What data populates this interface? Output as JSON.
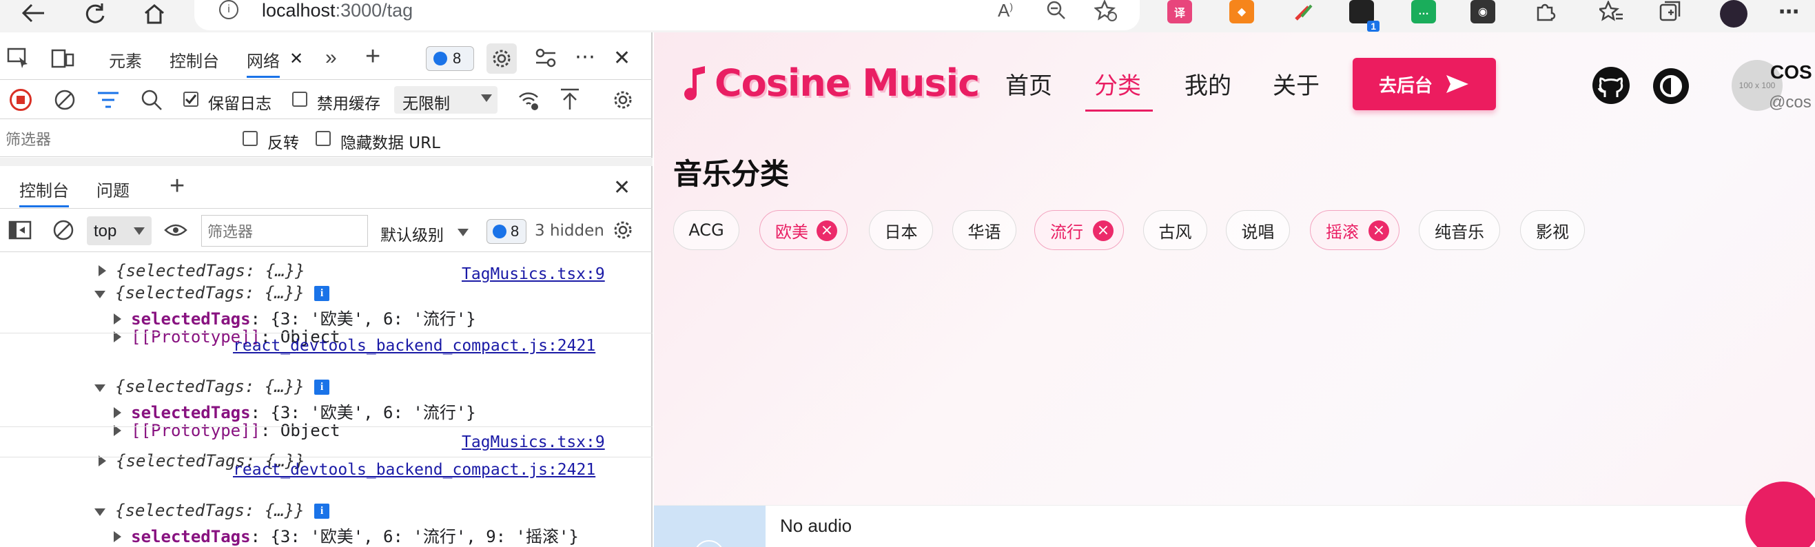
{
  "browser": {
    "url_host": "localhost",
    "url_path": ":3000/tag",
    "ext_badge": "1"
  },
  "devtools": {
    "tabs": [
      "元素",
      "控制台",
      "网络"
    ],
    "active_tab": "网络",
    "issues_count": "8",
    "network": {
      "preserve_log": "保留日志",
      "disable_cache": "禁用缓存",
      "throttle": "无限制",
      "filter_placeholder": "筛选器",
      "invert": "反转",
      "hide_data_urls": "隐藏数据 URL"
    },
    "drawer": {
      "tabs": [
        "控制台",
        "问题"
      ],
      "context": "top",
      "filter_placeholder": "筛选器",
      "level": "默认级别",
      "msg_count": "8",
      "hidden": "3 hidden"
    },
    "console": {
      "collapsed_obj": "{selectedTags: {…}}",
      "key_selected": "selectedTags",
      "val_two": "{3: '欧美', 6: '流行'}",
      "val_three": "{3: '欧美', 6: '流行', 9: '摇滚'}",
      "proto_key": "[[Prototype]]",
      "proto_val": "Object",
      "src_tag": "TagMusics.tsx:9",
      "src_react": "react_devtools_backend_compact.js:2421"
    }
  },
  "site": {
    "logo": "Cosine Music",
    "nav": [
      "首页",
      "分类",
      "我的",
      "关于"
    ],
    "active_nav": "分类",
    "backend_button": "去后台",
    "avatar_placeholder": "100 x 100",
    "user_name": "COS",
    "user_handle": "@cos",
    "section_title": "音乐分类",
    "tags": [
      "ACG",
      "欧美",
      "日本",
      "华语",
      "流行",
      "古风",
      "说唱",
      "摇滚",
      "纯音乐",
      "影视"
    ],
    "selected_tags": [
      "欧美",
      "流行",
      "摇滚"
    ],
    "tag_remove_glyph": "×",
    "player_status": "No audio"
  },
  "colors": {
    "accent": "#e91e63",
    "devtools_link": "#1a1aa6",
    "console_key": "#881280"
  }
}
